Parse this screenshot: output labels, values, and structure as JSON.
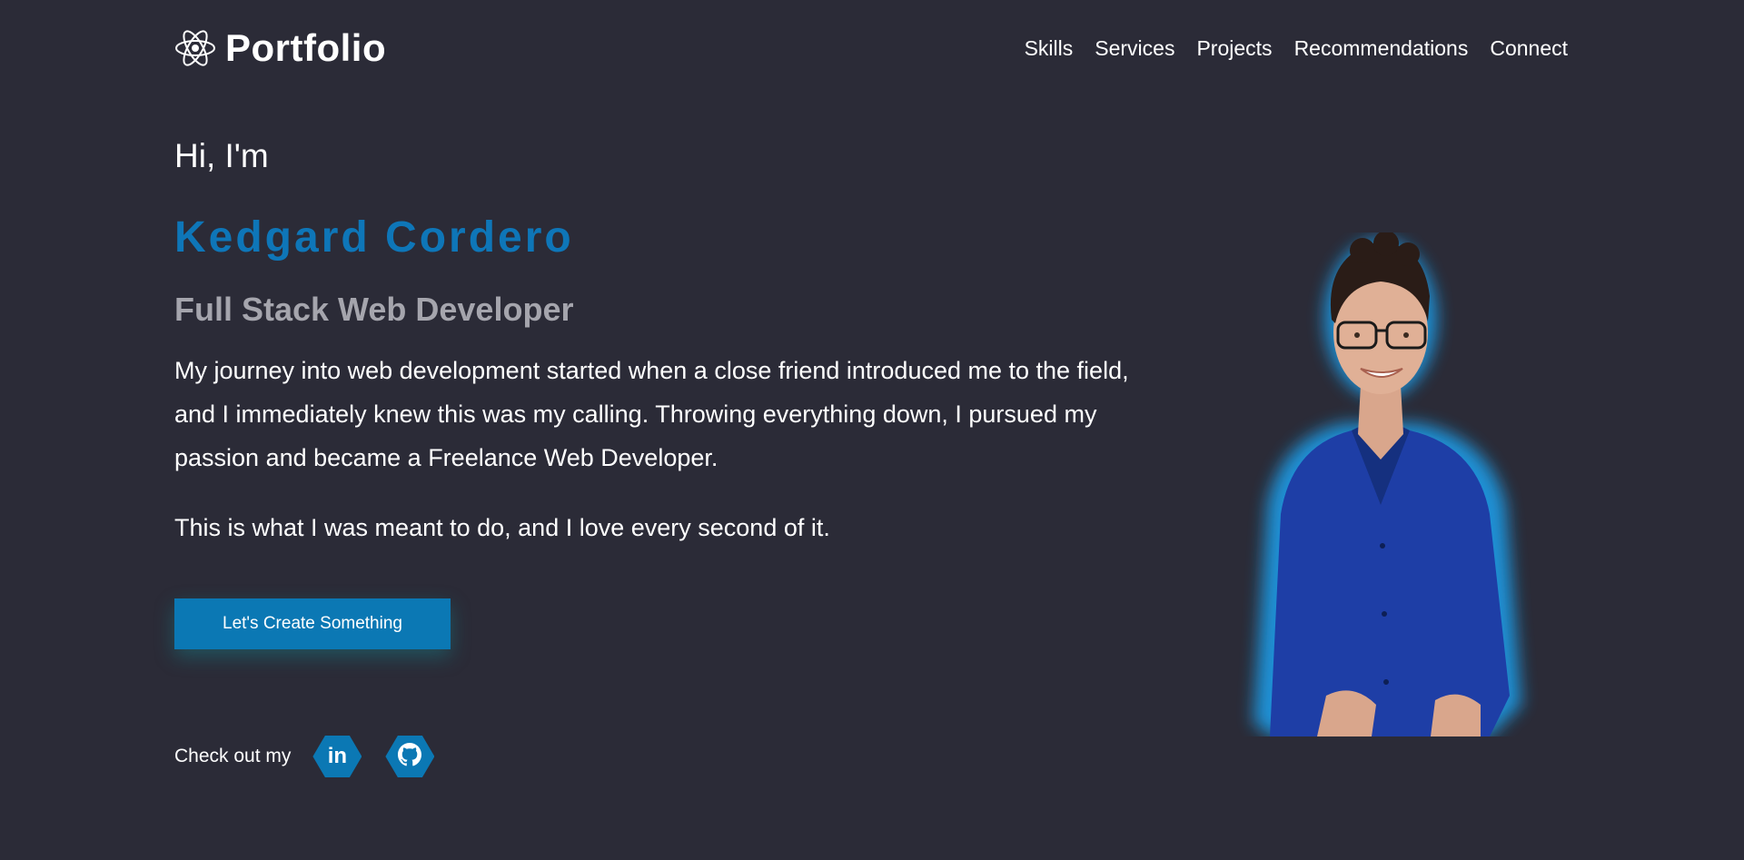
{
  "header": {
    "brand": "Portfolio",
    "logo_icon": "atom-icon",
    "nav": [
      "Skills",
      "Services",
      "Projects",
      "Recommendations",
      "Connect"
    ]
  },
  "hero": {
    "greeting": "Hi, I'm",
    "name": "Kedgard Cordero",
    "role": "Full Stack Web Developer",
    "bio": "My journey into web development started when a close friend introduced me to the field, and I immediately knew this was my calling. Throwing everything down, I pursued my passion and became a Freelance Web Developer.",
    "bio2": "This is what I was meant to do, and I love every second of it.",
    "cta": "Let's Create Something"
  },
  "socials": {
    "label": "Check out my",
    "links": [
      {
        "icon": "linkedin-icon",
        "glyph": "in"
      },
      {
        "icon": "github-icon"
      }
    ]
  },
  "colors": {
    "background": "#2b2b37",
    "accent": "#0b78b4",
    "muted_text": "#a5a5ad"
  }
}
